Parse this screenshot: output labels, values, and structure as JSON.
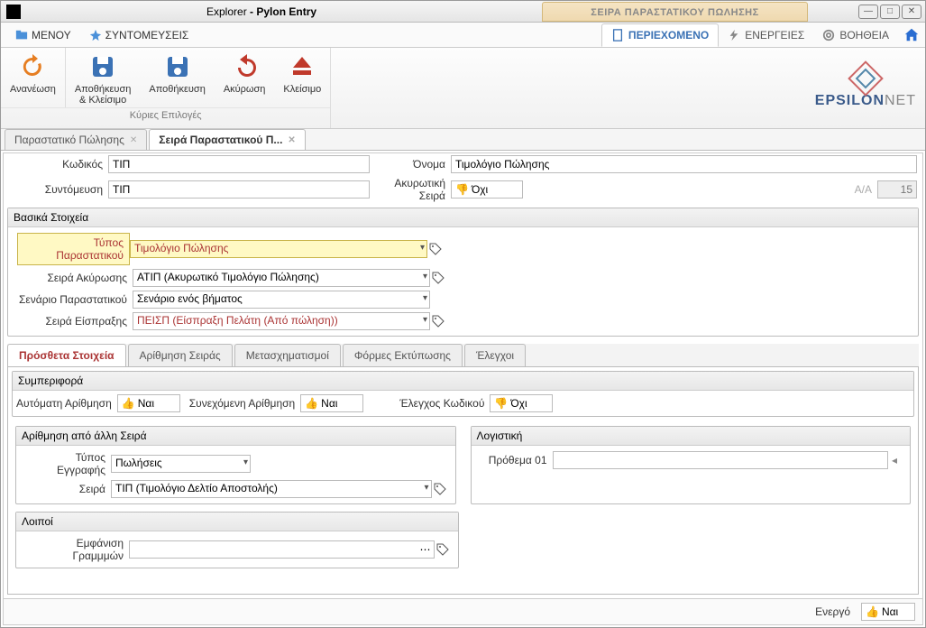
{
  "title": {
    "explorer": "Explorer",
    "app": "Pylon Entry",
    "context": "ΣΕΙΡΑ ΠΑΡΑΣΤΑΤΙΚΟΥ ΠΩΛΗΣΗΣ"
  },
  "menu": {
    "menu": "ΜΕΝΟΥ",
    "shortcuts": "ΣΥΝΤΟΜΕΥΣΕΙΣ",
    "tabs": {
      "content": "ΠΕΡΙΕΧΟΜΕΝΟ",
      "actions": "ΕΝΕΡΓΕΙΕΣ",
      "help": "ΒΟΗΘΕΙΑ"
    }
  },
  "ribbon": {
    "refresh": "Ανανέωση",
    "saveclose": "Αποθήκευση\n& Κλείσιμο",
    "save": "Αποθήκευση",
    "cancel": "Ακύρωση",
    "close": "Κλείσιμο",
    "group": "Κύριες Επιλογές"
  },
  "logo": {
    "main": "EPSILON",
    "suffix": "NET"
  },
  "doctabs": {
    "tab1": "Παραστατικό Πώλησης",
    "tab2": "Σειρά Παραστατικού Π..."
  },
  "form": {
    "code_l": "Κωδικός",
    "code_v": "ΤΙΠ",
    "name_l": "Όνομα",
    "name_v": "Τιμολόγιο Πώλησης",
    "abbr_l": "Συντόμευση",
    "abbr_v": "ΤΙΠ",
    "cancelseries_l": "Ακυρωτική Σειρά",
    "cancelseries_v": "Όχι",
    "aa_l": "A/A",
    "aa_v": "15"
  },
  "basic": {
    "title": "Βασικά Στοιχεία",
    "type_l": "Τύπος Παραστατικού",
    "type_v": "Τιμολόγιο Πώλησης",
    "cancel_l": "Σειρά Ακύρωσης",
    "cancel_v": "ΑΤΙΠ (Ακυρωτικό Τιμολόγιο Πώλησης)",
    "scenario_l": "Σενάριο Παραστατικού",
    "scenario_v": "Σενάριο ενός βήματος",
    "collect_l": "Σειρά Είσπραξης",
    "collect_v": "ΠΕΙΣΠ (Είσπραξη Πελάτη (Από πώληση))"
  },
  "subtabs": {
    "t1": "Πρόσθετα Στοιχεία",
    "t2": "Αρίθμηση Σειράς",
    "t3": "Μετασχηματισμοί",
    "t4": "Φόρμες Εκτύπωσης",
    "t5": "Έλεγχοι"
  },
  "behaviour": {
    "title": "Συμπεριφορά",
    "auto_l": "Αυτόματη Αρίθμηση",
    "auto_v": "Ναι",
    "cont_l": "Συνεχόμενη Αρίθμηση",
    "cont_v": "Ναι",
    "check_l": "Έλεγχος Κωδικού",
    "check_v": "Όχι"
  },
  "otherseries": {
    "title": "Αρίθμηση από άλλη Σειρά",
    "rectype_l": "Τύπος Εγγραφής",
    "rectype_v": "Πωλήσεις",
    "series_l": "Σειρά",
    "series_v": "ΤΙΠ (Τιμολόγιο Δελτίο Αποστολής)"
  },
  "accounting": {
    "title": "Λογιστική",
    "prefix_l": "Πρόθεμα 01",
    "prefix_v": ""
  },
  "other": {
    "title": "Λοιποί",
    "lines_l": "Εμφάνιση Γραμμμών",
    "lines_v": ""
  },
  "footer": {
    "active_l": "Ενεργό",
    "active_v": "Ναι"
  }
}
